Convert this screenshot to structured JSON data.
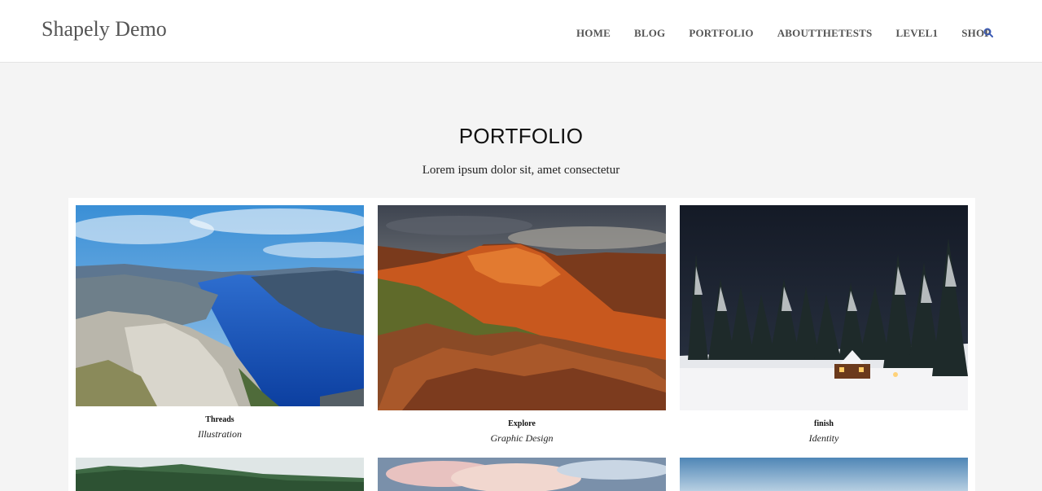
{
  "site": {
    "brand": "Shapely Demo"
  },
  "nav": {
    "items": [
      "HOME",
      "BLOG",
      "PORTFOLIO",
      "ABOUTTHETESTS",
      "LEVEL1",
      "SHOP"
    ],
    "search_icon": "search-icon",
    "accent_color": "#3b5bb5"
  },
  "section": {
    "title": "PORTFOLIO",
    "subtitle": "Lorem ipsum dolor sit, amet consectetur"
  },
  "portfolio": {
    "items": [
      {
        "title": "Threads",
        "category": "Illustration",
        "image": "fjord-landscape"
      },
      {
        "title": "Explore",
        "category": "Graphic Design",
        "image": "red-rock-canyon"
      },
      {
        "title": "finish",
        "category": "Identity",
        "image": "snowy-cabin-night"
      },
      {
        "title": "",
        "category": "",
        "image": "forest-mist"
      },
      {
        "title": "",
        "category": "",
        "image": "pink-clouds-sky"
      },
      {
        "title": "",
        "category": "",
        "image": "blue-sky-horizon"
      }
    ]
  }
}
